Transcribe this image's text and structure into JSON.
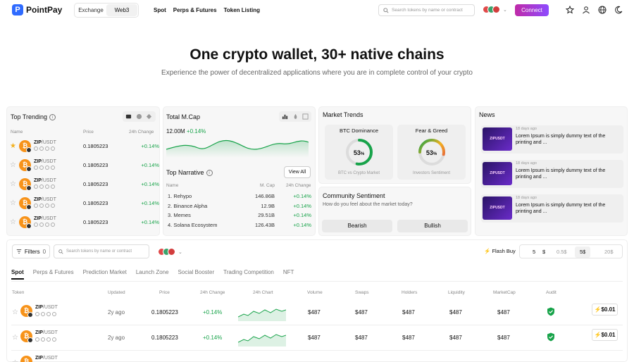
{
  "header": {
    "logo_text": "PointPay",
    "logo_mark": "P",
    "switch": [
      "Exchange",
      "Web3"
    ],
    "switch_active": "Web3",
    "nav": [
      "Spot",
      "Perps & Futures",
      "Token Listing"
    ],
    "search_placeholder": "Search tokens by name or contract",
    "connect_label": "Connect",
    "icons": [
      "star-icon",
      "user-icon",
      "globe-icon",
      "moon-icon"
    ]
  },
  "hero": {
    "title": "One crypto wallet, 30+ native chains",
    "subtitle": "Experience the power of decentralized applications where you are in complete control of your crypto"
  },
  "trending": {
    "title": "Top Trending",
    "col_name": "Name",
    "col_price": "Price",
    "col_change": "24h Change",
    "rows": [
      {
        "base": "ZIP",
        "quote": "/USDT",
        "price": "0.1805223",
        "change": "+0.14%",
        "starred": true
      },
      {
        "base": "ZIP",
        "quote": "/USDT",
        "price": "0.1805223",
        "change": "+0.14%",
        "starred": false
      },
      {
        "base": "ZIP",
        "quote": "/USDT",
        "price": "0.1805223",
        "change": "+0.14%",
        "starred": false
      },
      {
        "base": "ZIP",
        "quote": "/USDT",
        "price": "0.1805223",
        "change": "+0.14%",
        "starred": false
      },
      {
        "base": "ZIP",
        "quote": "/USDT",
        "price": "0.1805223",
        "change": "+0.14%",
        "starred": false
      }
    ]
  },
  "mcap": {
    "title": "Total M.Cap",
    "value": "12.00M",
    "change": "+0.14%"
  },
  "narrative": {
    "title": "Top Narrative",
    "view_all": "View All",
    "col_name": "Name",
    "col_mcap": "M. Cap",
    "col_change": "24h Change",
    "rows": [
      {
        "name": "1.  Rehypo",
        "mcap": "146.86B",
        "change": "+0.14%"
      },
      {
        "name": "2.  Binance Alpha",
        "mcap": "12.9B",
        "change": "+0.14%"
      },
      {
        "name": "3.  Memes",
        "mcap": "29.51B",
        "change": "+0.14%"
      },
      {
        "name": "4.  Solana Ecosystem",
        "mcap": "126.43B",
        "change": "+0.14%"
      }
    ]
  },
  "market_trends": {
    "title": "Market Trends",
    "btc_label": "BTC Dominance",
    "btc_value": "53",
    "btc_pct": "%",
    "btc_caption": "BTC vs Crypto Market",
    "btc_fraction": 0.53,
    "btc_color": "#18a34a",
    "fg_label": "Fear & Greed",
    "fg_value": "53",
    "fg_pct": "%",
    "fg_caption": "Investors Sentiment",
    "fg_fraction": 0.53
  },
  "community": {
    "title": "Community Sentiment",
    "question": "How do you feel about the market today?",
    "bearish": "Bearish",
    "bullish": "Bullish"
  },
  "news": {
    "title": "News",
    "items": [
      {
        "thumb": "ZIPUSDT",
        "date": "18 days ago",
        "text": "Lorem Ipsum is simply dummy text of the printing and ..."
      },
      {
        "thumb": "ZIPUSDT",
        "date": "18 days ago",
        "text": "Lorem Ipsum is simply dummy text of the printing and ..."
      },
      {
        "thumb": "ZIPUSDT",
        "date": "18 days ago",
        "text": "Lorem Ipsum is simply dummy text of the printing and ..."
      }
    ]
  },
  "toolbar": {
    "filters_label": "Filters",
    "filters_count": "0",
    "search_placeholder": "Search tokens by name or contract",
    "flash_buy": "Flash Buy",
    "amount_input": "5",
    "amount_unit": "$",
    "presets": [
      "0.5$",
      "5$",
      "20$"
    ],
    "preset_selected": "5$"
  },
  "tabs": [
    "Spot",
    "Perps & Futures",
    "Prediction Market",
    "Launch Zone",
    "Social Booster",
    "Trading Competition",
    "NFT"
  ],
  "table": {
    "headers": [
      "Token",
      "Updated",
      "Price",
      "24h Change",
      "24h Chart",
      "Volume",
      "Swaps",
      "Holders",
      "Liquidity",
      "MarketCap",
      "Audit"
    ],
    "rows": [
      {
        "base": "ZIP",
        "quote": "/USDT",
        "updated": "2y ago",
        "price": "0.1805223",
        "change": "+0.14%",
        "volume": "$487",
        "swaps": "$487",
        "holders": "$487",
        "liquidity": "$487",
        "mcap": "$487",
        "buy": "$0.01"
      },
      {
        "base": "ZIP",
        "quote": "/USDT",
        "updated": "2y ago",
        "price": "0.1805223",
        "change": "+0.14%",
        "volume": "$487",
        "swaps": "$487",
        "holders": "$487",
        "liquidity": "$487",
        "mcap": "$487",
        "buy": "$0.01"
      },
      {
        "base": "ZIP",
        "quote": "/USDT",
        "updated": "",
        "price": "",
        "change": "",
        "volume": "",
        "swaps": "",
        "holders": "",
        "liquidity": "",
        "mcap": "",
        "buy": ""
      }
    ]
  },
  "colors": {
    "accent": "#2f6bff",
    "positive": "#18a34a",
    "coin": "#f7931a",
    "connect_gradient": [
      "#c02aa8",
      "#8d4bff"
    ]
  }
}
